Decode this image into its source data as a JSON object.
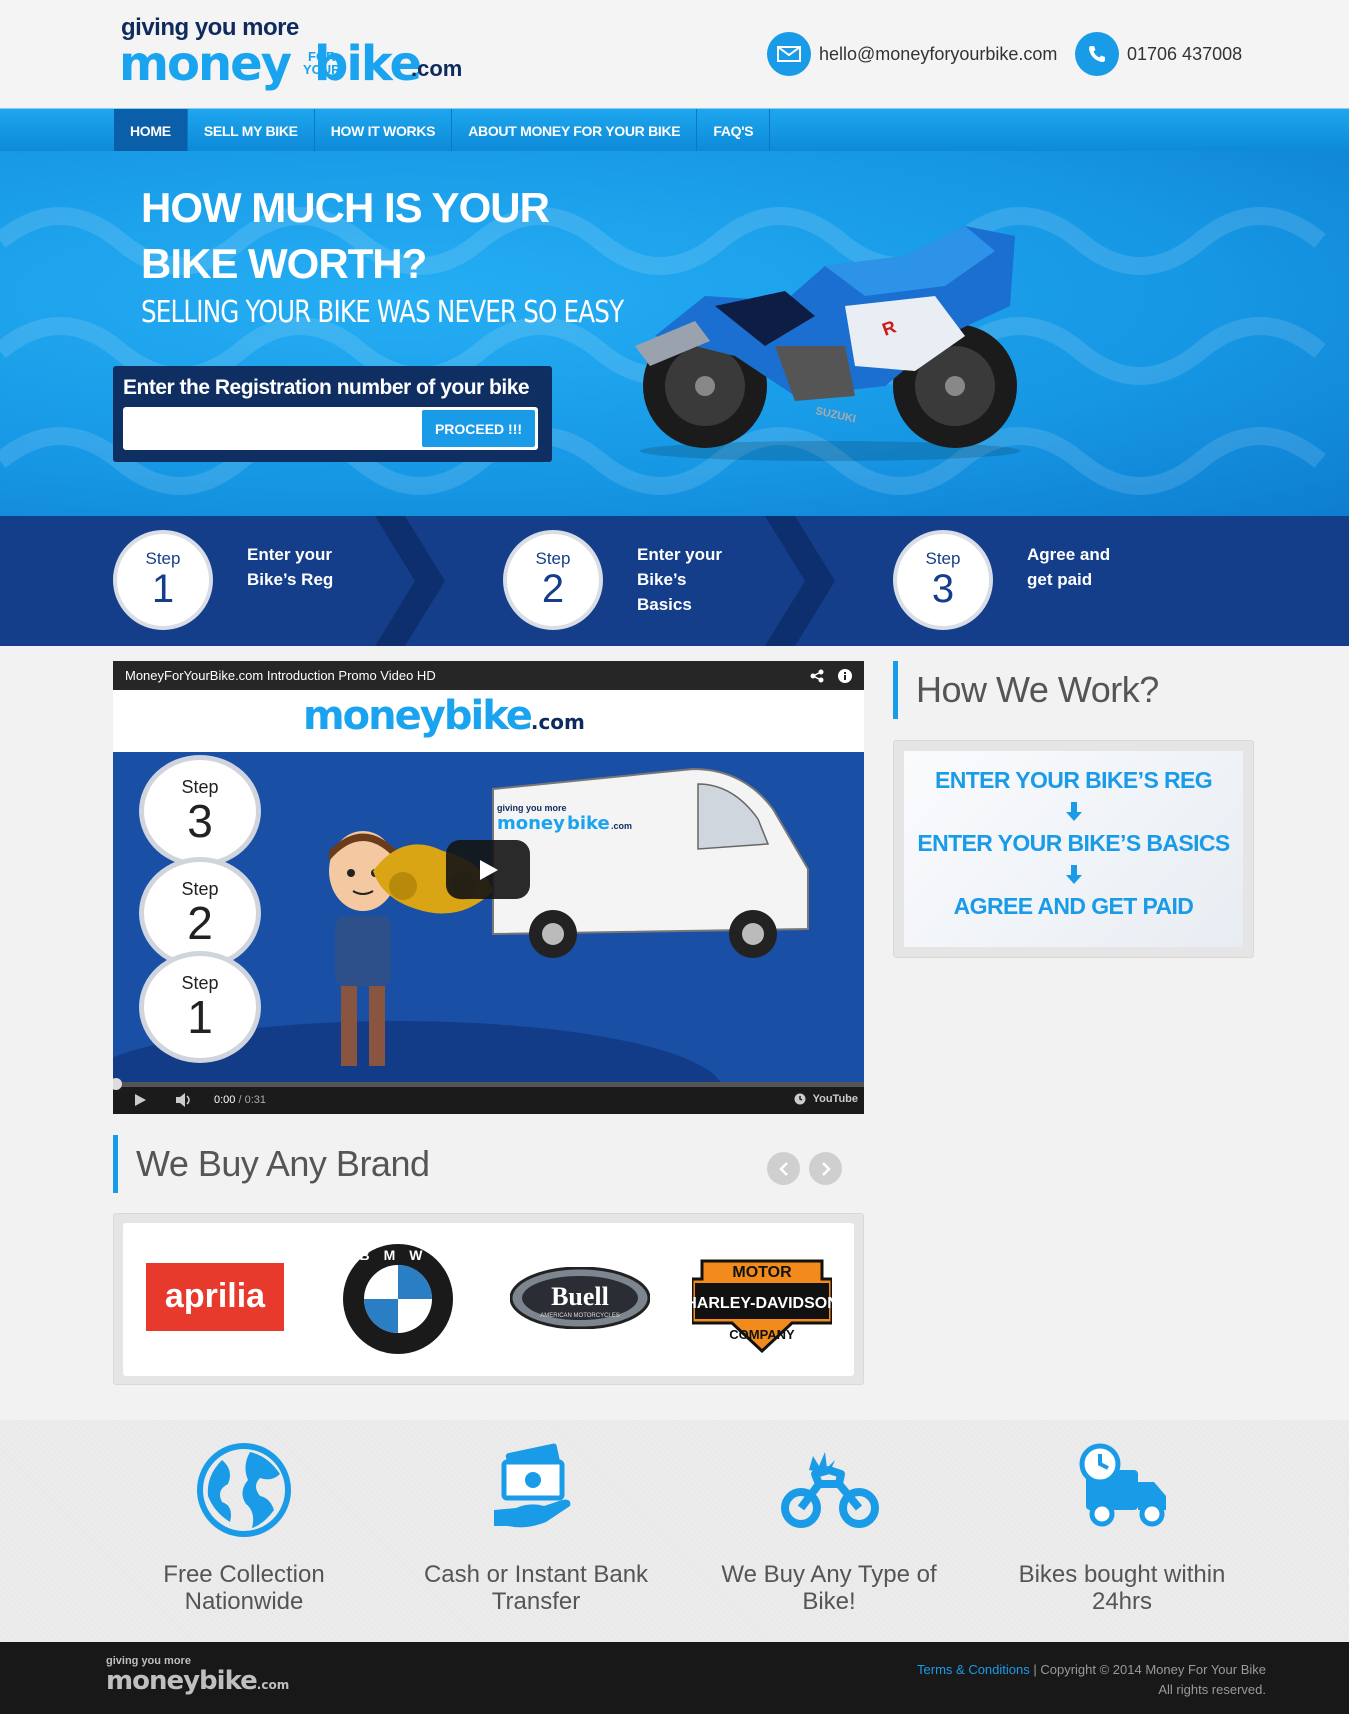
{
  "header": {
    "logo_tagline": "giving you more",
    "logo_money": "money",
    "logo_for": "FOR",
    "logo_your": "YOUR",
    "logo_bike": "bike",
    "logo_com": ".com",
    "email": "hello@moneyforyourbike.com",
    "phone": "01706 437008"
  },
  "nav": {
    "items": [
      {
        "label": "HOME",
        "active": true
      },
      {
        "label": "SELL MY BIKE"
      },
      {
        "label": "HOW IT WORKS"
      },
      {
        "label": "ABOUT MONEY FOR YOUR BIKE"
      },
      {
        "label": "FAQ'S"
      }
    ]
  },
  "hero": {
    "heading": "HOW MUCH IS YOUR BIKE WORTH?",
    "subheading": "SELLING YOUR BIKE WAS NEVER SO EASY",
    "reg_label": "Enter the Registration number of your bike",
    "reg_placeholder": "",
    "proceed_label": "PROCEED !!!",
    "bike_brand": "SUZUKI"
  },
  "steps": [
    {
      "word": "Step",
      "num": "1",
      "line1": "Enter your",
      "line2": "Bike’s Reg",
      "line3": ""
    },
    {
      "word": "Step",
      "num": "2",
      "line1": "Enter your",
      "line2": "Bike’s",
      "line3": "Basics"
    },
    {
      "word": "Step",
      "num": "3",
      "line1": "Agree and",
      "line2": "get paid",
      "line3": ""
    }
  ],
  "video": {
    "title": "MoneyForYourBike.com Introduction Promo Video HD",
    "logo": "money",
    "logo_bike": "bike",
    "logo_com": ".com",
    "time_current": "0:00",
    "time_total": "/ 0:31",
    "youtube": "YouTube",
    "steps": [
      {
        "word": "Step",
        "num": "3"
      },
      {
        "word": "Step",
        "num": "2"
      },
      {
        "word": "Step",
        "num": "1"
      }
    ]
  },
  "how_we_work": {
    "title": "How We Work?",
    "line1": "ENTER YOUR BIKE’S REG",
    "line2": "ENTER YOUR BIKE’S BASICS",
    "line3": "AGREE AND GET PAID"
  },
  "brands": {
    "title": "We Buy Any Brand",
    "items": [
      {
        "name": "aprilia"
      },
      {
        "name": "BMW"
      },
      {
        "name": "Buell"
      },
      {
        "name": "HARLEY-DAVIDSON"
      }
    ],
    "buell_sub": "AMERICAN MOTORCYCLES",
    "hd_top": "MOTOR",
    "hd_bottom": "COMPANY"
  },
  "features": [
    {
      "line1": "Free Collection",
      "line2": "Nationwide",
      "icon": "globe-icon"
    },
    {
      "line1": "Cash or Instant Bank",
      "line2": "Transfer",
      "icon": "cash-hand-icon"
    },
    {
      "line1": "We Buy Any Type of",
      "line2": "Bike!",
      "icon": "motorbike-icon"
    },
    {
      "line1": "Bikes bought within",
      "line2": "24hrs",
      "icon": "delivery-truck-icon"
    }
  ],
  "footer": {
    "logo_tagline": "giving you more",
    "logo_text": "money",
    "logo_bike": "bike",
    "logo_com": ".com",
    "terms_link": "Terms & Conditions",
    "copyright": " | Copyright © 2014 Money For Your Bike",
    "rights": "All rights reserved."
  },
  "colors": {
    "brand_blue": "#1a9be8",
    "navy": "#143e8a",
    "dark_navy": "#0f2f63"
  }
}
